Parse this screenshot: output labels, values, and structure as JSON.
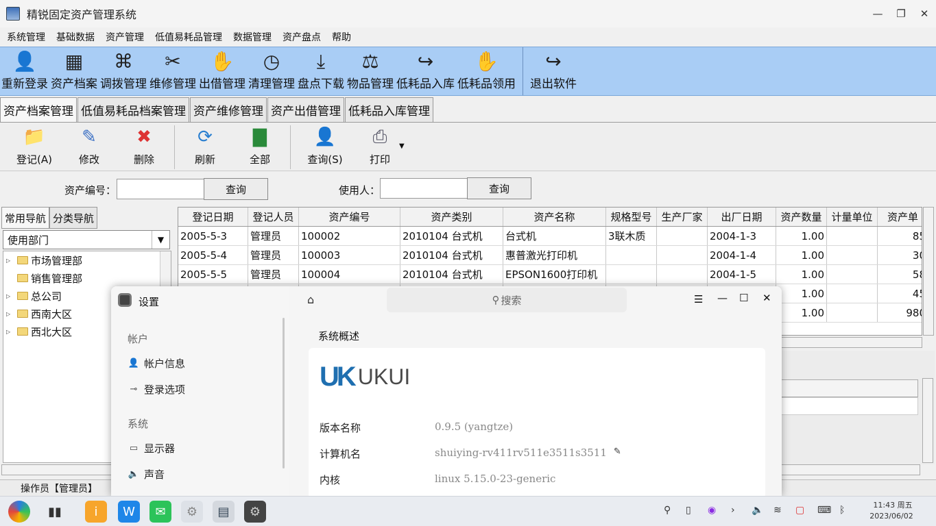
{
  "window": {
    "title": "精锐固定资产管理系统"
  },
  "menu": [
    "系统管理",
    "基础数据",
    "资产管理",
    "低值易耗品管理",
    "数据管理",
    "资产盘点",
    "帮助"
  ],
  "toolbar": [
    {
      "label": "重新登录",
      "icon": "user-icon"
    },
    {
      "label": "资产档案",
      "icon": "ledger-icon"
    },
    {
      "label": "调拨管理",
      "icon": "transfer-icon"
    },
    {
      "label": "维修管理",
      "icon": "tools-icon"
    },
    {
      "label": "出借管理",
      "icon": "handshake-icon"
    },
    {
      "label": "清理管理",
      "icon": "clock-icon"
    },
    {
      "label": "盘点下载",
      "icon": "download-icon"
    },
    {
      "label": "物品管理",
      "icon": "scale-icon"
    },
    {
      "label": "低耗品入库",
      "icon": "arrow-icon"
    },
    {
      "label": "低耗品领用",
      "icon": "handshake-icon"
    },
    {
      "label": "退出软件",
      "icon": "exit-arrow-icon"
    }
  ],
  "tabs": [
    "资产档案管理",
    "低值易耗品档案管理",
    "资产维修管理",
    "资产出借管理",
    "低耗品入库管理"
  ],
  "actions": [
    {
      "label": "登记(A)",
      "icon": "add-folder-icon"
    },
    {
      "label": "修改",
      "icon": "edit-icon"
    },
    {
      "label": "删除",
      "icon": "delete-folder-icon"
    },
    {
      "label": "刷新",
      "icon": "refresh-icon"
    },
    {
      "label": "全部",
      "icon": "chart-icon"
    },
    {
      "label": "查询(S)",
      "icon": "search-user-icon"
    },
    {
      "label": "打印",
      "icon": "printer-icon"
    }
  ],
  "search": {
    "asset_label": "资产编号：",
    "asset_btn": "查询",
    "user_label": "使用人：",
    "user_btn": "查询"
  },
  "nav": {
    "tabs": [
      "常用导航",
      "分类导航"
    ],
    "combo": "使用部门",
    "tree": [
      {
        "label": "市场管理部",
        "expandable": true
      },
      {
        "label": "销售管理部",
        "expandable": false
      },
      {
        "label": "总公司",
        "expandable": true
      },
      {
        "label": "西南大区",
        "expandable": true
      },
      {
        "label": "西北大区",
        "expandable": true
      }
    ]
  },
  "grid": {
    "columns": [
      "登记日期",
      "登记人员",
      "资产编号",
      "资产类别",
      "资产名称",
      "规格型号",
      "生产厂家",
      "出厂日期",
      "资产数量",
      "计量单位",
      "资产单"
    ],
    "rows": [
      [
        "2005-5-3",
        "管理员",
        "100002",
        "2010104 台式机",
        "台式机",
        "3联木质",
        "",
        "2004-1-3",
        "1.00",
        "",
        "85"
      ],
      [
        "2005-5-4",
        "管理员",
        "100003",
        "2010104 台式机",
        "惠普激光打印机",
        "",
        "",
        "2004-1-4",
        "1.00",
        "",
        "30"
      ],
      [
        "2005-5-5",
        "管理员",
        "100004",
        "2010104 台式机",
        "EPSON1600打印机",
        "",
        "",
        "2004-1-5",
        "1.00",
        "",
        "58"
      ],
      [
        "",
        "",
        "",
        "",
        "",
        "",
        "",
        "",
        "1.00",
        "",
        "45"
      ],
      [
        "",
        "",
        "",
        "",
        "",
        "",
        "",
        "",
        "1.00",
        "",
        "980"
      ]
    ]
  },
  "status": {
    "operator": "操作员【管理员】"
  },
  "settings": {
    "title": "设置",
    "search": "搜索",
    "groups": [
      {
        "name": "帐户",
        "items": [
          {
            "label": "帐户信息",
            "icon": "account-icon"
          },
          {
            "label": "登录选项",
            "icon": "key-icon"
          }
        ]
      },
      {
        "name": "系统",
        "items": [
          {
            "label": "显示器",
            "icon": "monitor-icon"
          },
          {
            "label": "声音",
            "icon": "sound-icon"
          }
        ]
      }
    ],
    "section": "系统概述",
    "logo_text": "UKUI",
    "info": [
      {
        "k": "版本名称",
        "v": "0.9.5 (yangtze)"
      },
      {
        "k": "计算机名",
        "v": "shuiying-rv411rv511e3511s3511"
      },
      {
        "k": "内核",
        "v": "linux 5.15.0-23-generic"
      }
    ]
  },
  "taskbar": {
    "time": "11:43 周五",
    "date": "2023/06/02"
  }
}
